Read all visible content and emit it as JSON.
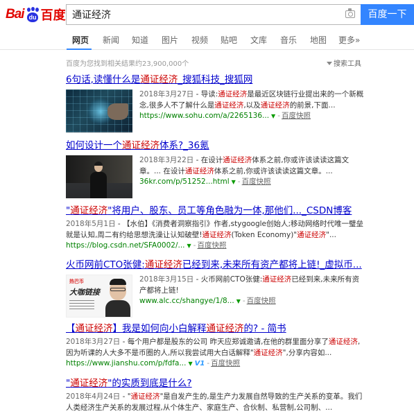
{
  "header": {
    "logo_bai": "Bai",
    "logo_du": "du",
    "logo_zh": "百度",
    "search_value": "通证经济",
    "search_button": "百度一下"
  },
  "tabs": [
    "网页",
    "新闻",
    "知道",
    "图片",
    "视频",
    "贴吧",
    "文库",
    "音乐",
    "地图",
    "更多»"
  ],
  "result_count": "百度为您找到相关结果约23,900,000个",
  "tools_label": "搜索工具",
  "results": [
    {
      "title_pre": "6句话,读懂什么是",
      "title_em": "通证经济",
      "title_post": "_搜狐科技_搜狐网",
      "date": "2018年3月27日",
      "abs_1": " - 导读:",
      "abs_em1": "通证经济",
      "abs_2": "是最近区块链行业提出来的一个新概念,很多人不了解什么是",
      "abs_em2": "通证经济",
      "abs_3": ",以及",
      "abs_em3": "通证经济",
      "abs_4": "的前景,下面...",
      "url": "https://www.sohu.com/a/2265136...",
      "snapshot": "百度快照"
    },
    {
      "title_pre": "如何设计一个",
      "title_em": "通证经济",
      "title_post": "体系?_36氪",
      "date": "2018年3月22日",
      "abs_1": " - 在设计",
      "abs_em1": "通证经济",
      "abs_2": "体系之前,你或许该读读这篇文章。... 在设计",
      "abs_em2": "通证经济",
      "abs_3": "体系之前,你或许该读读这篇文章。...",
      "url": "36kr.com/p/51252...html",
      "snapshot": "百度快照"
    },
    {
      "title_pre": "\"",
      "title_em": "通证经济",
      "title_post": "\"将用户、股东、员工等角色融为一体,那他们..._CSDN博客",
      "date": "2018年5月1日",
      "abs_1": " - 【水伯】《消费者洞察指引》作者,stygoogle创始人;移动网络时代唯一璧垒就是认知,周二有约给思想洗澡让认知破壁!",
      "abs_em1": "通证经济",
      "abs_2": "(Token Economy)\"",
      "abs_em2": "通证经济",
      "abs_3": "\"...",
      "url": "https://blog.csdn.net/SFA0002/...",
      "snapshot": "百度快照"
    },
    {
      "title_pre": "火币网前CTO张健:",
      "title_em": "通证经济",
      "title_post": "已经到来,未来所有资产都将上链!_虚拟币...",
      "date": "2018年3月15日",
      "abs_1": " - 火币网前CTO张健:",
      "abs_em1": "通证经济",
      "abs_2": "已经到来,未来所有资产都将上链!",
      "url": "www.alc.cc/shangye/1/8...",
      "snapshot": "百度快照",
      "thumb_brand": "热巴币",
      "thumb_big": "大咖链接"
    },
    {
      "title_pre": "【",
      "title_em": "通证经济",
      "title_post_a": "】我是如何向小白解释",
      "title_em2": "通证经济",
      "title_post": "的? - 简书",
      "date": "2018年3月27日",
      "abs_1": " - 每个用户都是股东的公司 昨天应郑诚邀请,在他的群里面分享了",
      "abs_em1": "通证经济",
      "abs_2": ",因为听课的人大多不是币圈的人,所以我尝试用大白话解释\"",
      "abs_em2": "通证经济",
      "abs_3": "\",分享内容如...",
      "url": "https://www.jianshu.com/p/fdfa...",
      "v1": "V1",
      "snapshot": "百度快照"
    },
    {
      "title_pre": "\"",
      "title_em": "通证经济",
      "title_post": "\"的实质到底是什么?",
      "date": "2018年4月24日",
      "abs_1": " - \"",
      "abs_em1": "通证经济",
      "abs_2": "\"是自发产生的,是生产力发展自然导致的生产关系的变革。我们人类经济生产关系的发展过程,从个体生产、家庭生产、合伙制、私营制,公司制、..."
    }
  ]
}
